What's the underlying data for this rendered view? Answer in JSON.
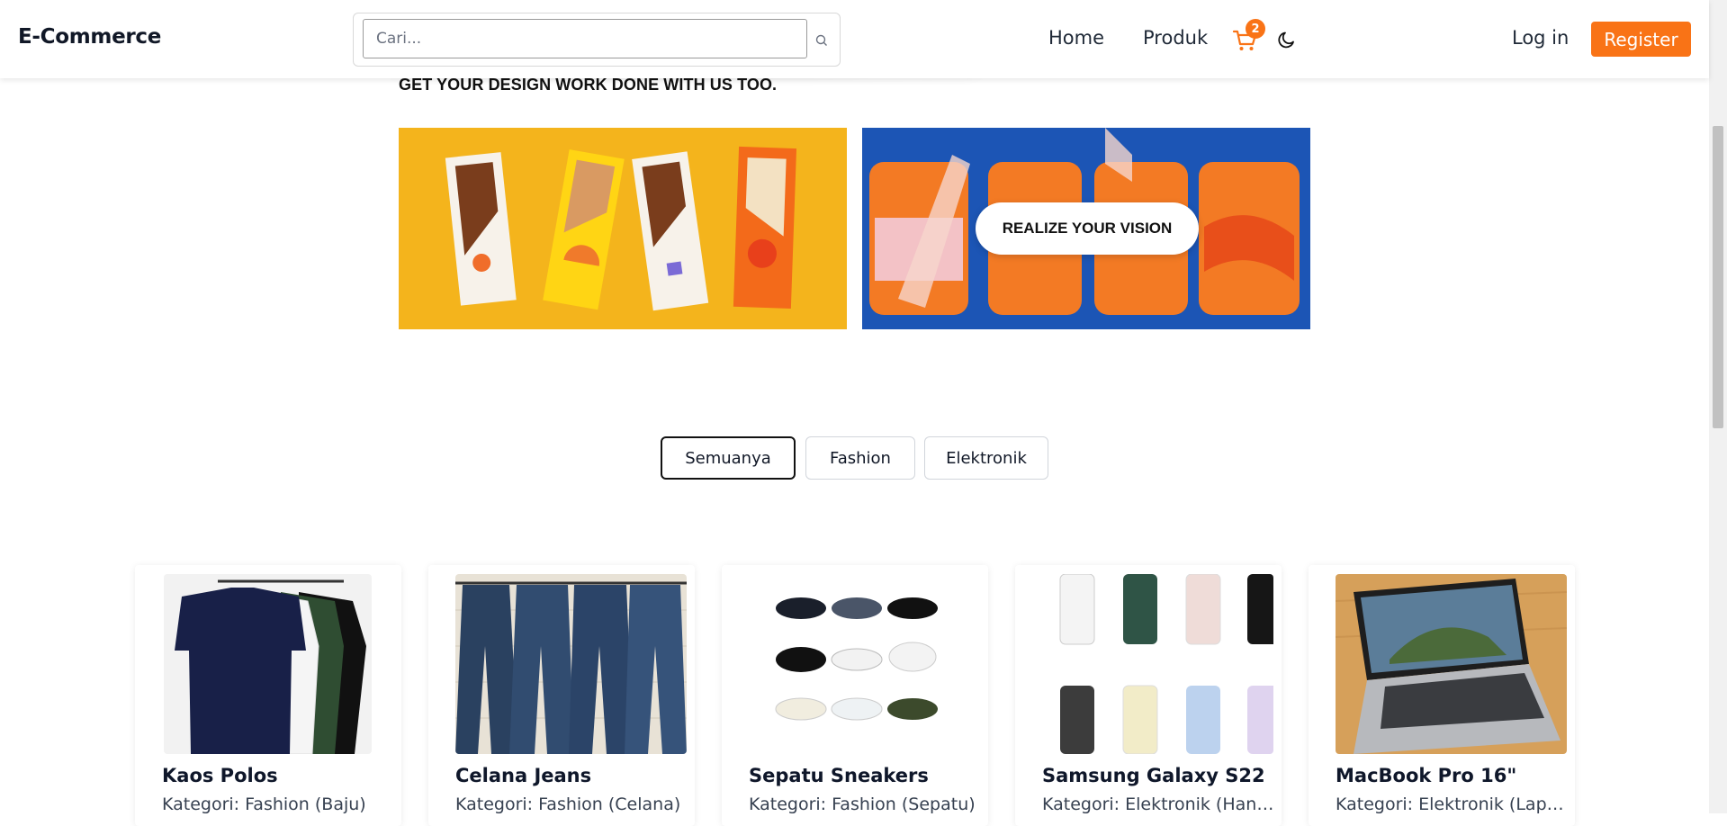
{
  "header": {
    "brand": "E-Commerce",
    "search_placeholder": "Cari...",
    "nav": {
      "home": "Home",
      "produk": "Produk"
    },
    "cart_count": "2",
    "login": "Log in",
    "register": "Register",
    "accent_color": "#f97316"
  },
  "hero": {
    "tagline": "GET YOUR DESIGN WORK DONE WITH US TOO.",
    "banner_right_text": "REALIZE YOUR VISION"
  },
  "filters": {
    "tabs": [
      "Semuanya",
      "Fashion",
      "Elektronik"
    ],
    "active": "Semuanya"
  },
  "products": [
    {
      "name": "Kaos Polos",
      "category": "Kategori: Fashion (Baju)"
    },
    {
      "name": "Celana Jeans",
      "category": "Kategori: Fashion (Celana)"
    },
    {
      "name": "Sepatu Sneakers",
      "category": "Kategori: Fashion (Sepatu)"
    },
    {
      "name": "Samsung Galaxy S22",
      "category": "Kategori: Elektronik (Handphone)"
    },
    {
      "name": "MacBook Pro 16\"",
      "category": "Kategori: Elektronik (Laptop)"
    }
  ],
  "icons": {
    "search": "search-icon",
    "cart": "cart-icon",
    "theme": "moon-icon"
  }
}
